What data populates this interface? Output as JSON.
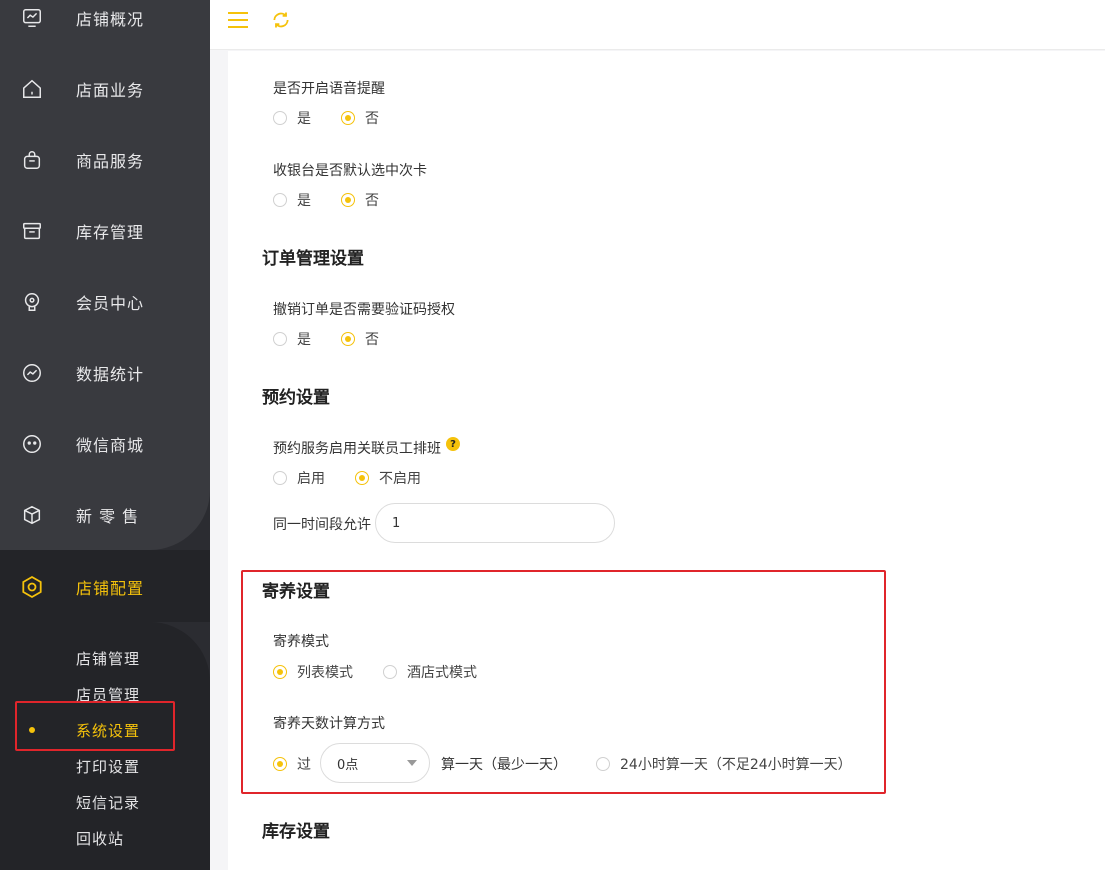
{
  "sidebar": {
    "items": [
      {
        "label": "店铺概况",
        "icon": "monitor-icon"
      },
      {
        "label": "店面业务",
        "icon": "home-icon"
      },
      {
        "label": "商品服务",
        "icon": "bag-icon"
      },
      {
        "label": "库存管理",
        "icon": "box-icon"
      },
      {
        "label": "会员中心",
        "icon": "member-icon"
      },
      {
        "label": "数据统计",
        "icon": "chart-icon"
      },
      {
        "label": "微信商城",
        "icon": "wechat-icon"
      },
      {
        "label": "新 零 售",
        "icon": "cube-icon"
      },
      {
        "label": "店铺配置",
        "icon": "settings-icon"
      }
    ],
    "sub_items": [
      {
        "label": "店铺管理"
      },
      {
        "label": "店员管理"
      },
      {
        "label": "系统设置"
      },
      {
        "label": "打印设置"
      },
      {
        "label": "短信记录"
      },
      {
        "label": "回收站"
      }
    ]
  },
  "topbar": {
    "menu_icon": "hamburger-icon",
    "refresh_icon": "refresh-icon"
  },
  "voice": {
    "label": "是否开启语音提醒",
    "yes": "是",
    "no": "否",
    "selected": "否"
  },
  "cashier": {
    "label": "收银台是否默认选中次卡",
    "yes": "是",
    "no": "否",
    "selected": "否"
  },
  "order_section": {
    "title": "订单管理设置"
  },
  "order_cancel": {
    "label": "撤销订单是否需要验证码授权",
    "yes": "是",
    "no": "否",
    "selected": "否"
  },
  "booking_section": {
    "title": "预约设置"
  },
  "booking_schedule": {
    "label": "预约服务启用关联员工排班",
    "help": "?",
    "enable": "启用",
    "disable": "不启用",
    "selected": "不启用"
  },
  "booking_same_time": {
    "label": "同一时间段允许",
    "value": "1"
  },
  "boarding_section": {
    "title": "寄养设置"
  },
  "boarding_mode": {
    "label": "寄养模式",
    "list": "列表模式",
    "hotel": "酒店式模式",
    "selected": "列表模式"
  },
  "boarding_days": {
    "label": "寄养天数计算方式",
    "option1_prefix": "过",
    "option1_select": "0点",
    "option1_suffix": "算一天（最少一天）",
    "option2": "24小时算一天（不足24小时算一天）",
    "selected": "option1"
  },
  "stock_section": {
    "title": "库存设置"
  },
  "colors": {
    "accent": "#f5c20b",
    "highlight": "#e0252b",
    "sidebar": "#393a3f"
  }
}
